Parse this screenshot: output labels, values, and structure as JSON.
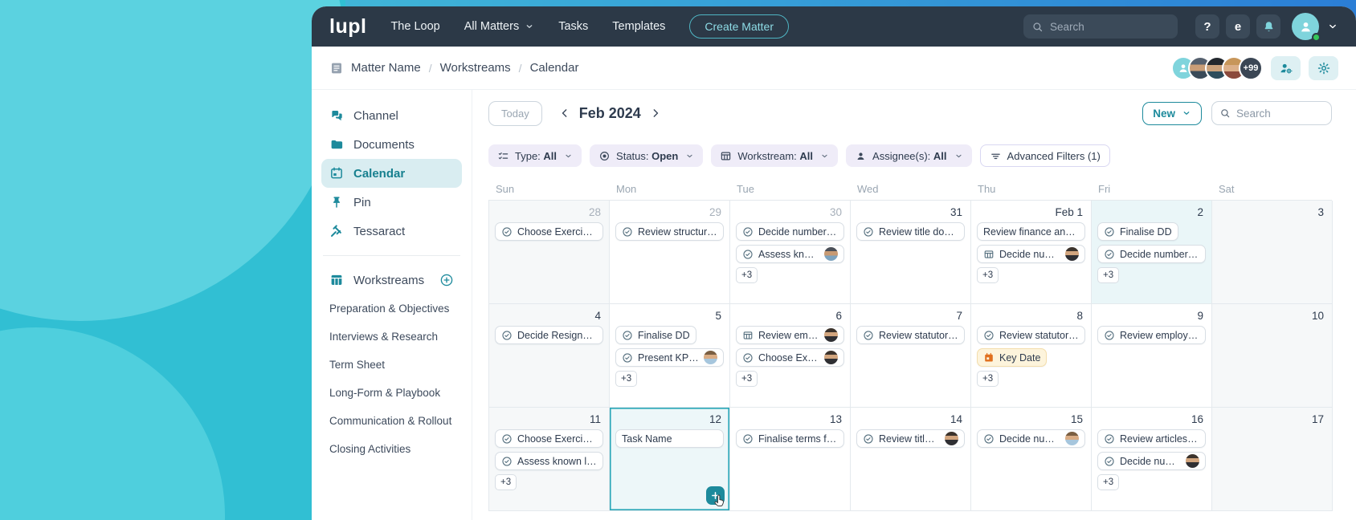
{
  "colors": {
    "accent": "#1d8a9c",
    "nav_bg": "#2c3947",
    "teal_light": "#7fd4dc",
    "selection_border": "#2aa7b8",
    "keydate_orange": "#e0701e",
    "keydate_bg": "#fdf4dc",
    "filter_chip_bg": "#efecf8",
    "highlight_cell_bg": "#eaf6f8",
    "weekend_cell_bg": "#f6f8f9",
    "presence_green": "#35c759"
  },
  "nav": {
    "logo": "lupl",
    "items": [
      {
        "label": "The Loop"
      },
      {
        "label": "All Matters",
        "dropdown": true
      },
      {
        "label": "Tasks"
      },
      {
        "label": "Templates"
      }
    ],
    "create_button": "Create Matter",
    "search_placeholder": "Search",
    "help_label": "?",
    "app_badge": "e"
  },
  "breadcrumb": {
    "items": [
      "Matter Name",
      "Workstreams",
      "Calendar"
    ],
    "avatars": [
      "p1",
      "p2",
      "p3"
    ],
    "overflow": "+99"
  },
  "sidebar": {
    "items": [
      {
        "label": "Channel",
        "icon": "chat"
      },
      {
        "label": "Documents",
        "icon": "folder"
      },
      {
        "label": "Calendar",
        "icon": "calendar",
        "active": true
      },
      {
        "label": "Pin",
        "icon": "pin"
      },
      {
        "label": "Tessaract",
        "icon": "gavel"
      }
    ],
    "workstreams": {
      "label": "Workstreams",
      "items": [
        "Preparation & Objectives",
        "Interviews & Research",
        "Term Sheet",
        "Long-Form & Playbook",
        "Communication & Rollout",
        "Closing Activities"
      ]
    }
  },
  "toolbar": {
    "today_label": "Today",
    "month_label": "Feb 2024",
    "new_label": "New",
    "search_placeholder": "Search"
  },
  "filters": {
    "chips": [
      {
        "icon": "type",
        "label": "Type:",
        "value": "All"
      },
      {
        "icon": "status",
        "label": "Status:",
        "value": "Open"
      },
      {
        "icon": "workstream",
        "label": "Workstream:",
        "value": "All"
      },
      {
        "icon": "assignee",
        "label": "Assignee(s):",
        "value": "All"
      }
    ],
    "advanced_label": "Advanced Filters (1)"
  },
  "calendar": {
    "weekdays": [
      "Sun",
      "Mon",
      "Tue",
      "Wed",
      "Thu",
      "Fri",
      "Sat"
    ],
    "rows": [
      [
        {
          "date": "28",
          "out": true,
          "tasks": [
            {
              "label": "Choose Exercise p...",
              "icon": "check"
            }
          ]
        },
        {
          "date": "29",
          "out": true,
          "tasks": [
            {
              "label": "Review structure...",
              "icon": "check"
            }
          ]
        },
        {
          "date": "30",
          "out": true,
          "tasks": [
            {
              "label": "Decide number of...",
              "icon": "check"
            },
            {
              "label": "Assess known...",
              "icon": "check",
              "avatar": "m1"
            }
          ],
          "more": "+3"
        },
        {
          "date": "31",
          "tasks": [
            {
              "label": "Review title docu...",
              "icon": "check"
            }
          ]
        },
        {
          "date": "Feb 1",
          "tasks": [
            {
              "label": "Review finance and s..."
            },
            {
              "label": "Decide numbe...",
              "icon": "grid",
              "avatar": "f1"
            }
          ],
          "more": "+3"
        },
        {
          "date": "2",
          "highlight": true,
          "tasks": [
            {
              "label": "Finalise DD",
              "icon": "check"
            },
            {
              "label": "Decide number of...",
              "icon": "check"
            }
          ],
          "more": "+3"
        },
        {
          "date": "3",
          "tasks": []
        }
      ],
      [
        {
          "date": "4",
          "tasks": [
            {
              "label": "Decide Resignatio...",
              "icon": "check"
            }
          ]
        },
        {
          "date": "5",
          "tasks": [
            {
              "label": "Finalise DD",
              "icon": "check"
            },
            {
              "label": "Present KPIs t...",
              "icon": "check",
              "avatar": "m2"
            }
          ],
          "more": "+3"
        },
        {
          "date": "6",
          "tasks": [
            {
              "label": "Review emplo...",
              "icon": "grid",
              "avatar": "f1"
            },
            {
              "label": "Choose Exerci...",
              "icon": "check",
              "avatar": "f1"
            }
          ],
          "more": "+3"
        },
        {
          "date": "7",
          "tasks": [
            {
              "label": "Review statutory...",
              "icon": "check"
            }
          ]
        },
        {
          "date": "8",
          "tasks": [
            {
              "label": "Review statutory...",
              "icon": "check"
            },
            {
              "label": "Key Date",
              "icon": "keydate",
              "keydate": true
            }
          ],
          "more": "+3"
        },
        {
          "date": "9",
          "tasks": [
            {
              "label": "Review employee...",
              "icon": "check"
            }
          ]
        },
        {
          "date": "10",
          "tasks": []
        }
      ],
      [
        {
          "date": "11",
          "tasks": [
            {
              "label": "Choose Exercise p...",
              "icon": "check"
            },
            {
              "label": "Assess known lia...",
              "icon": "check"
            }
          ],
          "more": "+3"
        },
        {
          "date": "12",
          "selected": true,
          "tasks": [
            {
              "label": "Task Name",
              "input": true
            }
          ],
          "add": true,
          "cursor": true
        },
        {
          "date": "13",
          "tasks": [
            {
              "label": "Finalise terms for...",
              "icon": "check"
            }
          ]
        },
        {
          "date": "14",
          "tasks": [
            {
              "label": "Review title d...",
              "icon": "check",
              "avatar": "f1"
            }
          ]
        },
        {
          "date": "15",
          "tasks": [
            {
              "label": "Decide numbe...",
              "icon": "check",
              "avatar": "m2"
            }
          ]
        },
        {
          "date": "16",
          "tasks": [
            {
              "label": "Review articles of...",
              "icon": "check"
            },
            {
              "label": "Decide numbe...",
              "icon": "check",
              "avatar": "f1"
            }
          ],
          "more": "+3"
        },
        {
          "date": "17",
          "tasks": []
        }
      ]
    ]
  }
}
